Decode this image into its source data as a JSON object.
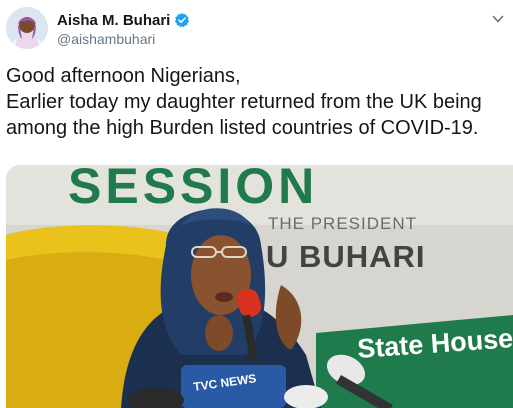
{
  "author": {
    "display_name": "Aisha M. Buhari",
    "handle": "@aishambuhari",
    "verified": true
  },
  "menu": {
    "icon": "chevron-down-icon"
  },
  "tweet": {
    "lines": [
      "Good afternoon Nigerians,",
      "Earlier today my daughter returned from the UK being",
      "among the high Burden listed countries of COVID-19."
    ]
  },
  "media": {
    "banner_title": "SESSION",
    "banner_subtitle": "THE PRESIDENT",
    "banner_name": "U BUHARI",
    "banner_green_text": "State House",
    "mic_label": "TVC NEWS"
  },
  "colors": {
    "verified_blue": "#1da1f2",
    "banner_green": "#1f7a4c",
    "chair_yellow": "#e9c21c"
  }
}
